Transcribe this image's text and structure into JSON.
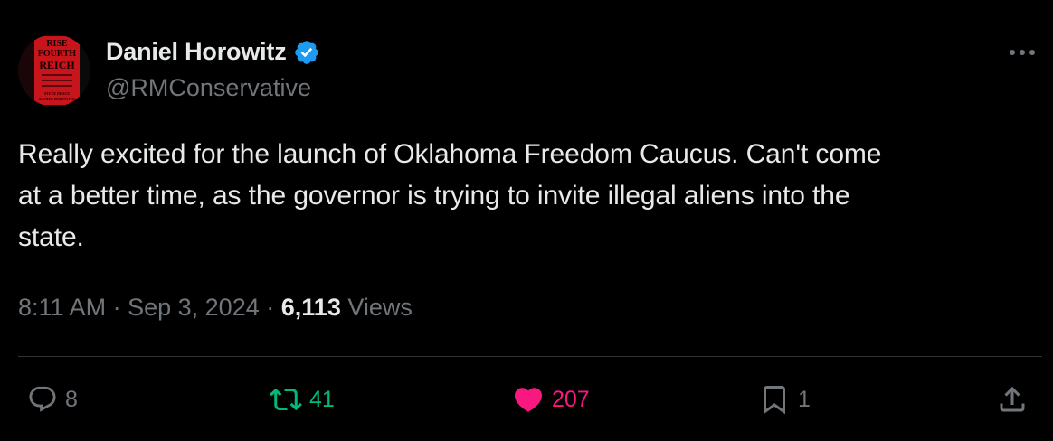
{
  "author": {
    "display_name": "Daniel Horowitz",
    "handle": "@RMConservative",
    "verified": true,
    "avatar_icon": "book-cover-avatar",
    "avatar_text": [
      "RISE",
      "FOURTH",
      "REICH",
      "STEVE DEACE",
      "DANIEL HOROWITZ"
    ]
  },
  "tweet": {
    "text_lines": [
      "Really excited for the launch of Oklahoma Freedom Caucus. Can't come",
      "at a better time, as the governor is trying to invite illegal aliens into the",
      "state."
    ],
    "time": "8:11 AM",
    "date": "Sep 3, 2024",
    "separator": "·",
    "views_count": "6,113",
    "views_label": "Views"
  },
  "actions": {
    "reply_count": "8",
    "retweet_count": "41",
    "like_count": "207",
    "bookmark_count": "1"
  },
  "colors": {
    "background": "#000000",
    "text_primary": "#e7e9ea",
    "text_secondary": "#71767b",
    "verified": "#1d9bf0",
    "retweet": "#00ba7c",
    "like": "#f91880",
    "divider": "#2f3336"
  }
}
